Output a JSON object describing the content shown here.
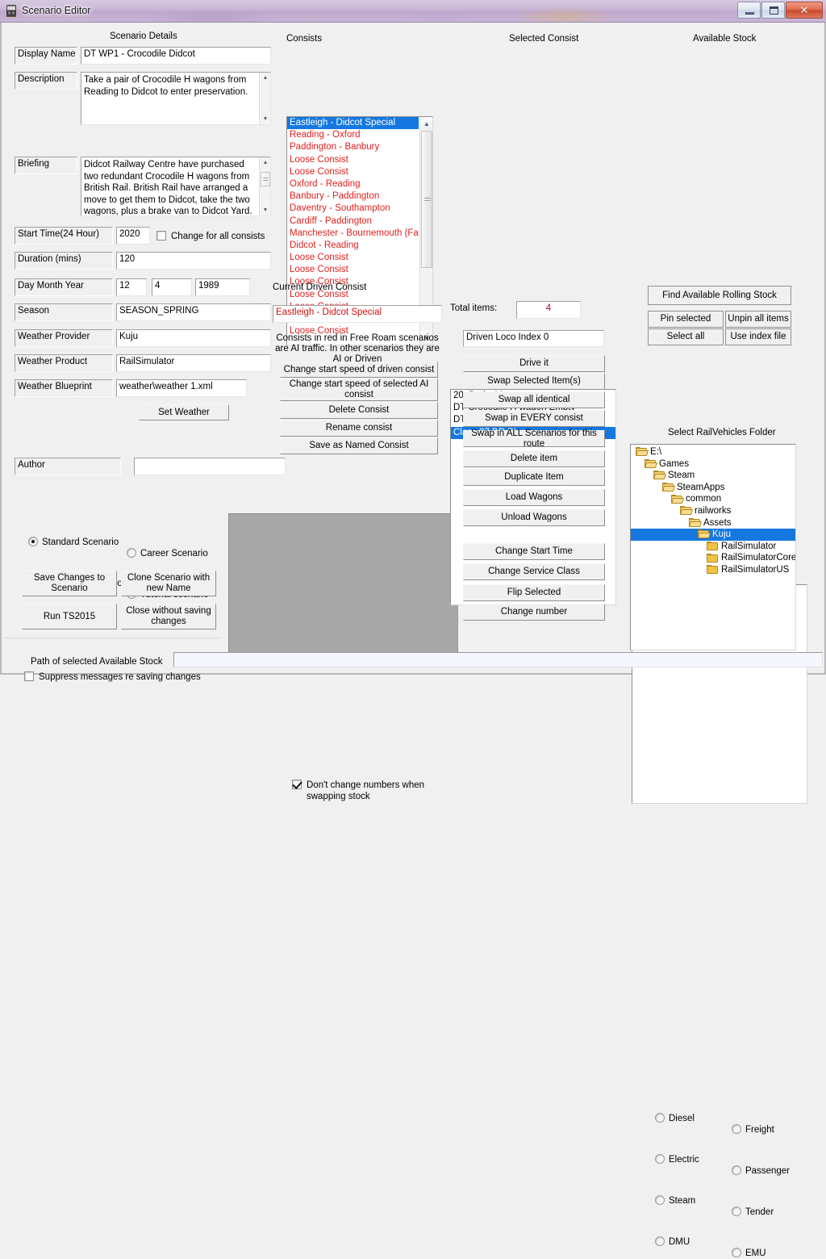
{
  "window": {
    "title": "Scenario Editor",
    "icon": "app-icon",
    "minimize_label": "",
    "maximize_label": "",
    "close_label": "✕"
  },
  "scenario_details": {
    "caption": "Scenario Details",
    "display_name_label": "Display Name",
    "display_name_value": "DT WP1 - Crocodile Didcot",
    "description_label": "Description",
    "description_value": "Take a pair of Crocodile H wagons from Reading to Didcot to enter preservation.",
    "briefing_label": "Briefing",
    "briefing_value": "Didcot Railway Centre have purchased two redundant Crocodile H wagons from British Rail. British Rail have arranged a move to get them to Didcot, take the two wagons, plus a brake van to Didcot Yard. Remember to make",
    "start_time_label": "Start Time(24 Hour)",
    "start_time_value": "2020",
    "change_all_consists_label": "Change for all consists",
    "change_all_consists_checked": false,
    "duration_label": "Duration (mins)",
    "duration_value": "120",
    "dmy_label": "Day Month Year",
    "day_value": "12",
    "month_value": "4",
    "year_value": "1989",
    "season_label": "Season",
    "season_value": "SEASON_SPRING",
    "weather_provider_label": "Weather Provider",
    "weather_provider_value": "Kuju",
    "weather_product_label": "Weather Product",
    "weather_product_value": "RailSimulator",
    "weather_blueprint_label": "Weather Blueprint",
    "weather_blueprint_value": "weather\\weather 1.xml",
    "set_weather_label": "Set Weather",
    "author_label": "Author",
    "author_value": ""
  },
  "scenario_type": {
    "options": [
      {
        "label": "Standard Scenario",
        "selected": true
      },
      {
        "label": "Career Scenario",
        "selected": false
      },
      {
        "label": "Free roam scenario",
        "selected": false
      },
      {
        "label": "Tutorial scenario",
        "selected": false
      }
    ]
  },
  "actions": {
    "save_changes_label": "Save Changes to Scenario",
    "clone_scenario_label": "Clone Scenario with new Name",
    "run_ts_label": "Run TS2015",
    "close_without_saving_label": "Close without saving changes",
    "suppress_messages_label": "Suppress messages re saving changes",
    "suppress_messages_checked": false
  },
  "consists": {
    "caption": "Consists",
    "items": [
      {
        "label": "Eastleigh - Didcot Special",
        "selected": true,
        "red": false
      },
      {
        "label": "Reading - Oxford",
        "selected": false,
        "red": true
      },
      {
        "label": "Paddington - Banbury",
        "selected": false,
        "red": true
      },
      {
        "label": "Loose Consist",
        "selected": false,
        "red": true
      },
      {
        "label": "Loose Consist",
        "selected": false,
        "red": true
      },
      {
        "label": "Oxford - Reading",
        "selected": false,
        "red": true
      },
      {
        "label": "Banbury - Paddington",
        "selected": false,
        "red": true
      },
      {
        "label": "Daventry - Southampton",
        "selected": false,
        "red": true
      },
      {
        "label": "Cardiff - Paddington",
        "selected": false,
        "red": true
      },
      {
        "label": "Manchester - Bournemouth (Failed)",
        "selected": false,
        "red": true
      },
      {
        "label": "Didcot - Reading",
        "selected": false,
        "red": true
      },
      {
        "label": "Loose Consist",
        "selected": false,
        "red": true
      },
      {
        "label": "Loose Consist",
        "selected": false,
        "red": true
      },
      {
        "label": "Loose Consist",
        "selected": false,
        "red": true
      },
      {
        "label": "Loose Consist",
        "selected": false,
        "red": true
      },
      {
        "label": "Loose Consist",
        "selected": false,
        "red": true
      },
      {
        "label": "Loose Consist",
        "selected": false,
        "red": true
      },
      {
        "label": "Loose Consist",
        "selected": false,
        "red": true
      }
    ]
  },
  "current_driven_consist": {
    "caption": "Current Driven Consist",
    "value": "Eastleigh - Didcot Special",
    "note": "Consists in red in Free Roam scenarios are AI traffic. In other scenarios they are AI or Driven",
    "buttons": [
      "Change start speed of driven consist",
      "Change start speed of selected AI consist",
      "Delete Consist",
      "Rename consist",
      "Save as Named Consist"
    ],
    "dont_change_numbers_label": "Don't change numbers when swapping stock",
    "dont_change_numbers_checked": true
  },
  "selected_consist": {
    "caption": "Selected Consist",
    "items": [
      {
        "label": "20t Brake Van",
        "selected": false
      },
      {
        "label": "DT Crocodile H wagon Empty",
        "selected": false
      },
      {
        "label": "DT Crocodile H wagon Empty",
        "selected": false
      },
      {
        "label": "Class 37 BR Blue",
        "selected": true
      }
    ],
    "total_items_label": "Total items:",
    "total_items_value": "4",
    "driven_loco_index_value": "Driven Loco Index 0",
    "buttons_group_a": [
      "Drive it",
      "Swap Selected Item(s)",
      "Swap all identical",
      "Swap in EVERY consist",
      "Swap in ALL Scenarios for this route",
      "Delete item",
      "Duplicate Item",
      "Load Wagons",
      "Unload Wagons"
    ],
    "buttons_group_b": [
      "Change Start Time",
      "Change Service Class",
      "Flip Selected",
      "Change number"
    ]
  },
  "available_stock": {
    "caption": "Available Stock",
    "items": [],
    "find_button_label": "Find Available Rolling Stock",
    "pin_selected_label": "Pin selected",
    "unpin_all_label": "Unpin all items",
    "select_all_label": "Select all",
    "use_index_file_label": "Use index file",
    "filters": [
      {
        "label": "Diesel",
        "selected": false
      },
      {
        "label": "Freight",
        "selected": false
      },
      {
        "label": "Electric",
        "selected": false
      },
      {
        "label": "Passenger",
        "selected": false
      },
      {
        "label": "Steam",
        "selected": false
      },
      {
        "label": "Tender",
        "selected": false
      },
      {
        "label": "DMU",
        "selected": false
      },
      {
        "label": "EMU",
        "selected": false
      }
    ],
    "folder_caption": "Select RailVehicles Folder",
    "tree": [
      {
        "label": "E:\\",
        "depth": 0,
        "open": true,
        "selected": false
      },
      {
        "label": "Games",
        "depth": 1,
        "open": true,
        "selected": false
      },
      {
        "label": "Steam",
        "depth": 2,
        "open": true,
        "selected": false
      },
      {
        "label": "SteamApps",
        "depth": 3,
        "open": true,
        "selected": false
      },
      {
        "label": "common",
        "depth": 4,
        "open": true,
        "selected": false
      },
      {
        "label": "railworks",
        "depth": 5,
        "open": true,
        "selected": false
      },
      {
        "label": "Assets",
        "depth": 6,
        "open": true,
        "selected": false
      },
      {
        "label": "Kuju",
        "depth": 7,
        "open": true,
        "selected": true
      },
      {
        "label": "RailSimulator",
        "depth": 8,
        "open": false,
        "selected": false
      },
      {
        "label": "RailSimulatorCore",
        "depth": 8,
        "open": false,
        "selected": false
      },
      {
        "label": "RailSimulatorUS",
        "depth": 8,
        "open": false,
        "selected": false
      }
    ]
  },
  "status_bar": {
    "path_label": "Path of selected Available Stock",
    "path_value": ""
  },
  "colors": {
    "accent_selection": "#1478e0",
    "consist_red": "#e02020",
    "total_red": "#b0003a",
    "window_bg": "#f0f0f0"
  }
}
